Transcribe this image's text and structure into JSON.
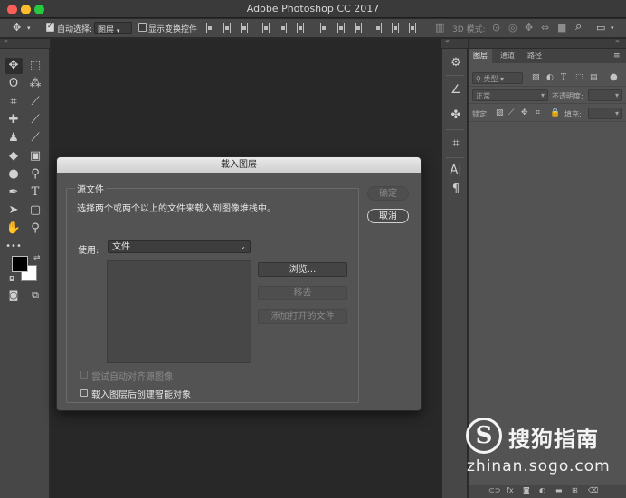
{
  "app": {
    "title": "Adobe Photoshop CC 2017"
  },
  "options_bar": {
    "auto_select_label": "自动选择:",
    "auto_select_target": "图层",
    "show_transform_label": "显示变换控件",
    "mode_3d_label": "3D 模式:"
  },
  "tools": {
    "items": [
      "move-tool",
      "marquee-tool",
      "lasso-tool",
      "magic-wand-tool",
      "crop-tool",
      "eyedropper-tool",
      "healing-brush-tool",
      "brush-tool",
      "clone-stamp-tool",
      "history-brush-tool",
      "eraser-tool",
      "gradient-tool",
      "blur-tool",
      "dodge-tool",
      "pen-tool",
      "type-tool",
      "path-selection-tool",
      "rectangle-tool",
      "hand-tool",
      "zoom-tool"
    ],
    "more_label": "•••",
    "fg_color": "#000000",
    "bg_color": "#ffffff"
  },
  "dock": {
    "icons": [
      "libraries-icon",
      "adjust-icon",
      "puzzle-icon",
      "crop-panel-icon",
      "character-icon",
      "paragraph-icon"
    ]
  },
  "layers_panel": {
    "tabs": [
      "图层",
      "通道",
      "路径"
    ],
    "filter_label": "类型",
    "blend_mode": "正常",
    "opacity_label": "不透明度:",
    "lock_label": "锁定:",
    "fill_label": "填充:"
  },
  "dialog": {
    "title": "载入图层",
    "group_label": "源文件",
    "description": "选择两个或两个以上的文件来载入到图像堆栈中。",
    "use_label": "使用:",
    "use_value": "文件",
    "browse_label": "浏览...",
    "remove_label": "移去",
    "add_open_label": "添加打开的文件",
    "ok_label": "确定",
    "cancel_label": "取消",
    "auto_align_label": "尝试自动对齐源图像",
    "smart_object_label": "载入图层后创建智能对象"
  },
  "watermark": {
    "brand": "搜狗指南",
    "url": "zhinan.sogo.com",
    "logo_letter": "S"
  },
  "colors": {
    "accent": "#fc5f57",
    "panel_bg": "#535353",
    "canvas_bg": "#282828"
  }
}
